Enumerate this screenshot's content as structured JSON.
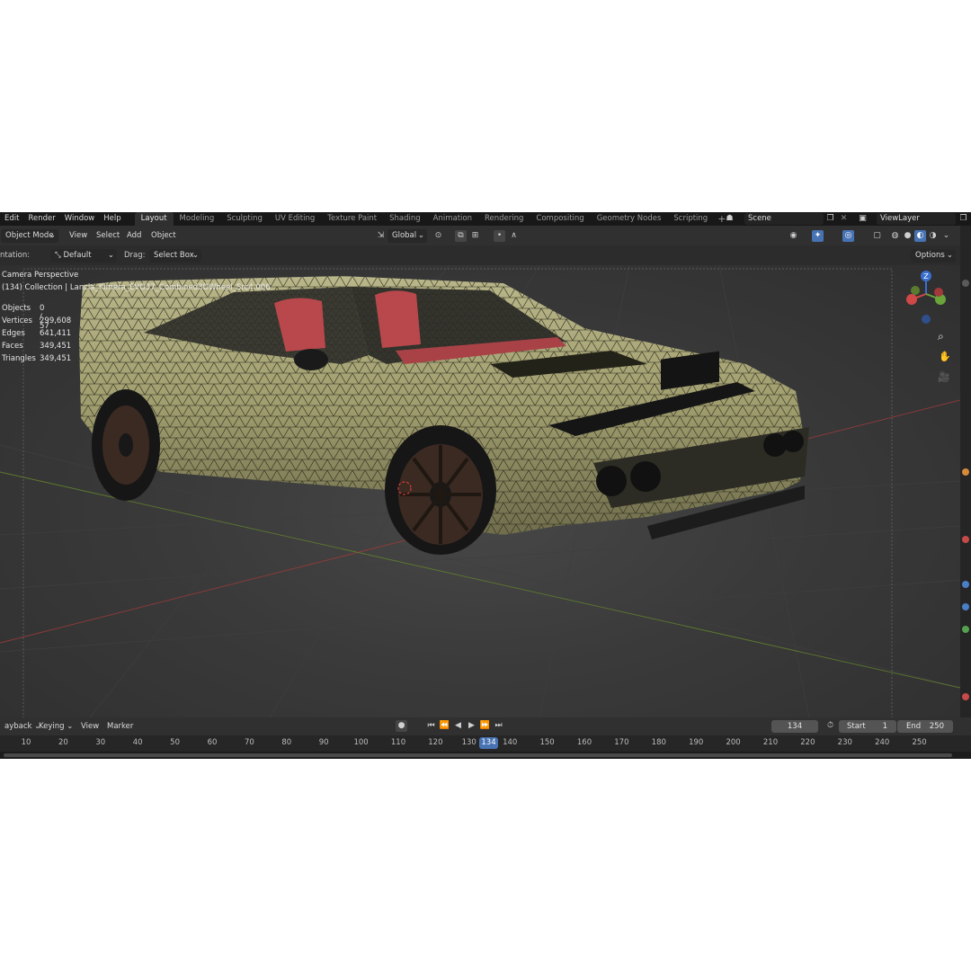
{
  "menu": [
    "Edit",
    "Render",
    "Window",
    "Help"
  ],
  "workspaces": [
    "Layout",
    "Modeling",
    "Sculpting",
    "UV Editing",
    "Texture Paint",
    "Shading",
    "Animation",
    "Rendering",
    "Compositing",
    "Geometry Nodes",
    "Scripting"
  ],
  "active_workspace": "Layout",
  "scene": "Scene",
  "view_layer": "ViewLayer",
  "header": {
    "mode": "Object Mode",
    "view": "View",
    "select": "Select",
    "add": "Add",
    "object": "Object",
    "transform": "Global"
  },
  "tool_settings": {
    "orientation_label": "ntation:",
    "orientation": "Default",
    "drag_label": "Drag:",
    "drag": "Select Box",
    "options": "Options"
  },
  "viewport": {
    "camera": "Camera Perspective",
    "collection": "(134) Collection | Lancia_Kimera_EVO37_Combined3DWheel_Src4.006",
    "stats": [
      {
        "label": "Objects",
        "value": "0 / 57"
      },
      {
        "label": "Vertices",
        "value": "299,608"
      },
      {
        "label": "Edges",
        "value": "641,411"
      },
      {
        "label": "Faces",
        "value": "349,451"
      },
      {
        "label": "Triangles",
        "value": "349,451"
      }
    ],
    "gizmo_z": "Z"
  },
  "timeline": {
    "playback": "ayback",
    "keying": "Keying",
    "view": "View",
    "marker": "Marker",
    "current_frame": "134",
    "start_label": "Start",
    "start": "1",
    "end_label": "End",
    "end": "250",
    "ticks": [
      "10",
      "20",
      "30",
      "40",
      "50",
      "60",
      "70",
      "80",
      "90",
      "100",
      "110",
      "120",
      "130",
      "140",
      "150",
      "160",
      "170",
      "180",
      "190",
      "200",
      "210",
      "220",
      "230",
      "240",
      "250"
    ]
  },
  "colors": {
    "accent": "#4772b3",
    "car_body": "#9d9a6c",
    "seat": "#b8484c"
  }
}
